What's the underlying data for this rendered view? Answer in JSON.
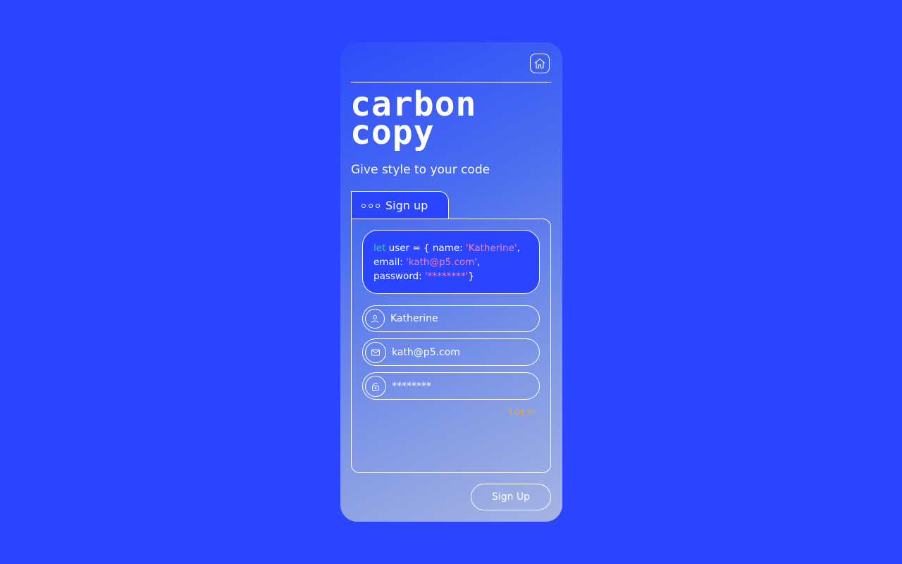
{
  "logo": {
    "line1": "carbon",
    "line2": "copy"
  },
  "tagline": "Give style to your code",
  "tab": {
    "label": "Sign up"
  },
  "code": {
    "keyword": "let",
    "line1_mid": " user = { name: ",
    "name_str": "'Katherine'",
    "line1_end": ",",
    "line2_prefix": "email: ",
    "email_str": "'kath@p5.com'",
    "line2_end": ",",
    "line3_prefix": "password: ",
    "password_str": "'********'",
    "line3_end": "}"
  },
  "fields": {
    "name": {
      "value": "Katherine",
      "icon": "user-icon"
    },
    "email": {
      "value": "kath@p5.com",
      "icon": "mail-icon"
    },
    "password": {
      "value": "********",
      "icon": "unlock-icon"
    }
  },
  "login_link": "Log In",
  "signup_button": "Sign Up",
  "colors": {
    "background": "#2a44ff",
    "keyword": "#22e082",
    "string": "#ff7eb6",
    "link": "#f5a623"
  }
}
